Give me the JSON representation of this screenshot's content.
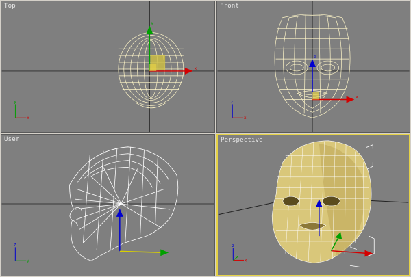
{
  "viewports": {
    "top": {
      "label": "Top"
    },
    "front": {
      "label": "Front"
    },
    "user": {
      "label": "User"
    },
    "perspective": {
      "label": "Perspective"
    }
  },
  "axes": {
    "x": "x",
    "y": "y",
    "z": "z"
  },
  "colors": {
    "viewport_bg": "#7f7f7f",
    "active_border": "#e5d246",
    "wire_selected": "#fff6c8",
    "wire_white": "#ffffff",
    "axis_x": "#d40000",
    "axis_y": "#00a000",
    "axis_z": "#0000d0",
    "shaded_face": "#d9c77a"
  }
}
